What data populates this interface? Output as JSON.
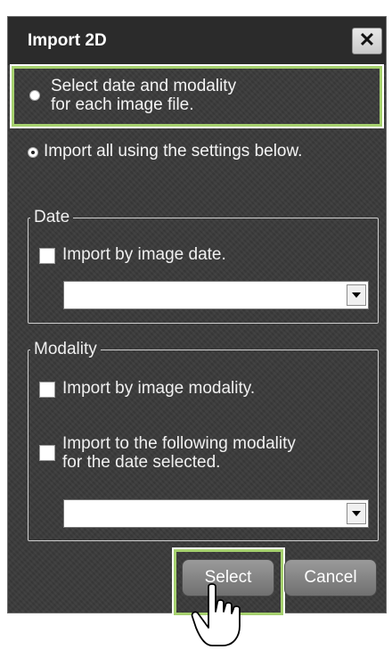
{
  "dialog": {
    "title": "Import 2D",
    "close_label": "✕"
  },
  "options": {
    "per_file_line1": "Select date and modality",
    "per_file_line2": "for each image file.",
    "import_all": "Import all using the settings below."
  },
  "date_group": {
    "legend": "Date",
    "checkbox_label": "Import by image date.",
    "selected_value": ""
  },
  "modality_group": {
    "legend": "Modality",
    "checkbox_by_modality": "Import by image modality.",
    "checkbox_following_line1": "Import to the following modality",
    "checkbox_following_line2": "for the date selected.",
    "selected_value": ""
  },
  "buttons": {
    "select": "Select",
    "cancel": "Cancel"
  },
  "colors": {
    "highlight": "#a6d16e",
    "dialog_bg": "#3a3a3a"
  }
}
